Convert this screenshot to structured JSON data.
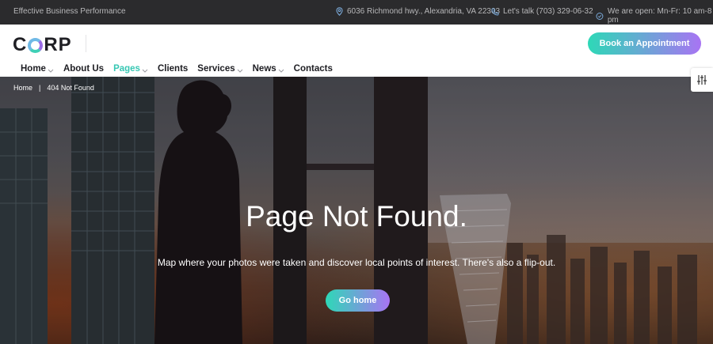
{
  "topbar": {
    "tagline": "Effective Business Performance",
    "address": "6036 Richmond hwy., Alexandria, VA 22303",
    "phone": "Let's talk (703) 329-06-32",
    "hours": "We are open: Mn-Fr: 10 am-8 pm"
  },
  "header": {
    "logo_text_left": "C",
    "logo_text_right": "RP",
    "cta_label": "Book an Appointment"
  },
  "nav": {
    "items": [
      {
        "label": "Home",
        "has_dropdown": true
      },
      {
        "label": "About Us",
        "has_dropdown": false
      },
      {
        "label": "Pages",
        "has_dropdown": true,
        "active": true
      },
      {
        "label": "Clients",
        "has_dropdown": false
      },
      {
        "label": "Services",
        "has_dropdown": true
      },
      {
        "label": "News",
        "has_dropdown": true
      },
      {
        "label": "Contacts",
        "has_dropdown": false
      }
    ]
  },
  "breadcrumb": {
    "home": "Home",
    "separator": "|",
    "current": "404 Not Found"
  },
  "hero": {
    "title": "Page Not Found.",
    "subtitle": "Map where your photos were taken and discover local points of interest. There's also a flip-out.",
    "button_label": "Go home"
  },
  "colors": {
    "accent_start": "#2ed8b7",
    "accent_end": "#a874f3",
    "active_nav": "#36c7b3",
    "topbar_bg": "#2b2b2d"
  },
  "icons": {
    "address": "map-pin-icon",
    "phone": "phone-icon",
    "hours": "clock-icon",
    "settings": "sliders-icon"
  }
}
